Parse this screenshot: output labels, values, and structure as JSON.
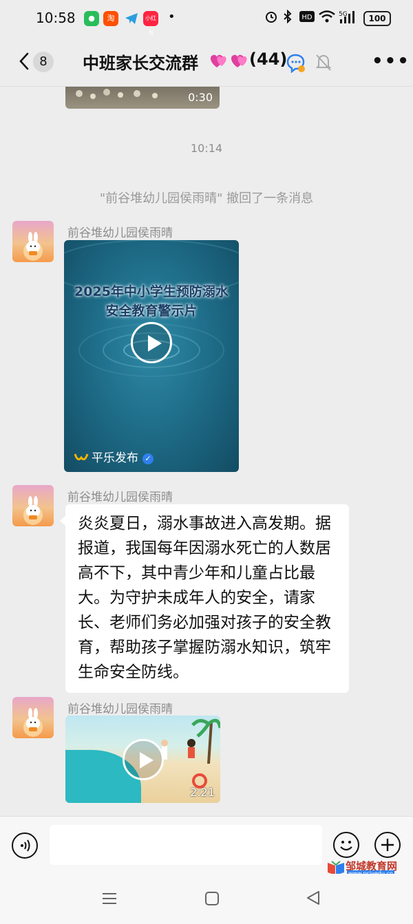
{
  "status_bar": {
    "time": "10:58",
    "app_icons": [
      "wechat-icon",
      "taobao-icon",
      "telegram-icon",
      "xiaohongshu-icon"
    ],
    "indicators": [
      "alarm-icon",
      "bluetooth-icon",
      "hd-icon",
      "wifi-icon",
      "5g-signal-icon"
    ],
    "battery": "100",
    "dot": "•"
  },
  "header": {
    "back_badge": "8",
    "title": "中班家长交流群",
    "member_count": "(44)",
    "more": "•••"
  },
  "messages": {
    "prev_video_duration": "0:30",
    "timestamp": "10:14",
    "recall_notice": "\"前谷堆幼儿园侯雨晴\" 撤回了一条消息",
    "msg1": {
      "sender": "前谷堆幼儿园侯雨晴",
      "video_title_line1": "2025年中小学生预防溺水",
      "video_title_line2": "安全教育警示片",
      "publisher": "平乐发布"
    },
    "msg2": {
      "sender": "前谷堆幼儿园侯雨晴",
      "text": "炎炎夏日，溺水事故进入高发期。据报道，我国每年因溺水死亡的人数居高不下，其中青少年和儿童占比最大。为守护未成年人的安全，请家长、老师们务必加强对孩子的安全教育，帮助孩子掌握防溺水知识，筑牢生命安全防线。"
    },
    "msg3": {
      "sender": "前谷堆幼儿园侯雨晴",
      "video_duration": "2:21"
    }
  },
  "watermark": {
    "name": "邹城教育网",
    "url": "www.pcjyedu.cn"
  },
  "colors": {
    "background": "#ededed",
    "bubble": "#ffffff",
    "meta_text": "#8d8d8d",
    "verify_blue": "#2f80ed"
  }
}
